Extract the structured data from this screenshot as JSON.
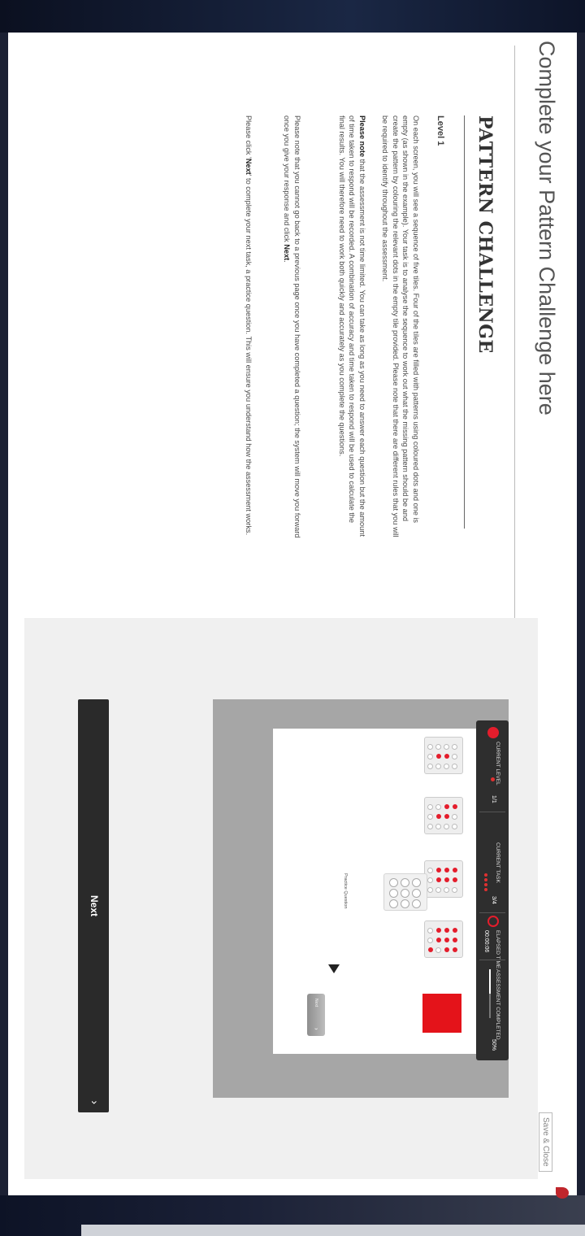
{
  "header": {
    "title": "Complete your Pattern Challenge here",
    "save_close": "Save & Close"
  },
  "content": {
    "page_title": "PATTERN CHALLENGE",
    "level_label": "Level 1",
    "p1": "On each screen, you will see a sequence of five tiles. Four of the tiles are filled with patterns using coloured dots and one is empty (as shown in the example). Your task is to analyse the sequence to work out what the missing pattern should be and create the pattern by colouring the relevant dots in the empty tile provided. Please note that there are different rules that you will be required to identify throughout the assessment.",
    "p2_bold": "Please note",
    "p2_rest": " that the assessment is not time limited. You can take as long as you need to answer each question but the amount of time taken to respond will be recorded. A combination of accuracy and time taken to respond will be used to calculate the final results. You will therefore need to work both quickly and accurately as you complete the questions.",
    "p3_a": "Please note that you cannot go back to a previous page once you have completed a question; the system will move you forward once you give your response and click ",
    "p3_bold": "Next",
    "p3_b": ".",
    "p4_a": "Please click '",
    "p4_bold": "Next",
    "p4_b": "' to complete your next task, a practice question. This will ensure you understand how the assessment works."
  },
  "example": {
    "level_label": "CURRENT LEVEL",
    "level_value": "1/1",
    "task_label": "CURRENT TASK",
    "task_value": "3/4",
    "time_label": "ELAPSED TIME",
    "time_value": "00:00:06",
    "progress_label": "ASSESSMENT COMPLETED",
    "progress_value": "50%",
    "progress_fraction": 0.5,
    "practice_label": "Practice Question",
    "small_button_label": "Next",
    "accent_color": "#e41d2c"
  },
  "footer": {
    "next_label": "Next",
    "next_icon": "chevron-right-icon"
  }
}
